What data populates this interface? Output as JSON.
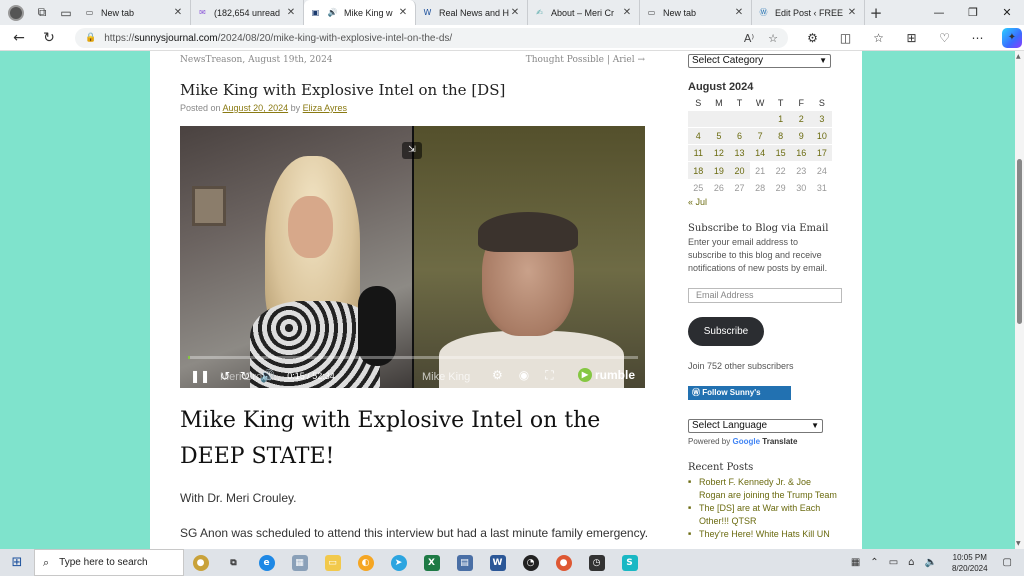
{
  "browser": {
    "tabs": [
      {
        "title": "New tab",
        "icon": "page-icon",
        "active": false
      },
      {
        "title": "(182,654 unread",
        "icon": "mail-icon",
        "active": false
      },
      {
        "title": "Mike King w",
        "icon": "site-icon",
        "active": true
      },
      {
        "title": "Real News and H",
        "icon": "w-icon",
        "active": false
      },
      {
        "title": "About – Meri Cr",
        "icon": "sign-icon",
        "active": false
      },
      {
        "title": "New tab",
        "icon": "page-icon",
        "active": false
      },
      {
        "title": "Edit Post ‹ FREE",
        "icon": "wordpress-icon",
        "active": false
      }
    ],
    "url_prefix": "https://",
    "url_domain": "sunnysjournal.com",
    "url_path": "/2024/08/20/mike-king-with-explosive-intel-on-the-ds/"
  },
  "post_nav": {
    "prev": "NewsTreason, August 19th, 2024",
    "next": "Thought Possible | Ariel →"
  },
  "post": {
    "title": "Mike King with Explosive Intel on the [DS]",
    "posted_on": "Posted on",
    "date": "August 20, 2024",
    "by": "by",
    "author": "Eliza Ayres",
    "big_title": "Mike King with Explosive Intel on the DEEP STATE!",
    "para1": "With Dr. Meri Crouley.",
    "para2": "SG Anon was scheduled to attend this interview but had a last minute family emergency."
  },
  "video": {
    "left_name": "Meri Croul...",
    "right_name": "Mike King",
    "time": "0:15 / 52:34",
    "progress": 0.005,
    "brand": "rumble"
  },
  "sidebar": {
    "category_select": "Select Category",
    "calendar": {
      "title": "August 2024",
      "weekdays": [
        "S",
        "M",
        "T",
        "W",
        "T",
        "F",
        "S"
      ],
      "prev_link": "« Jul",
      "weeks": [
        [
          "",
          "",
          "",
          "",
          "1",
          "2",
          "3"
        ],
        [
          "4",
          "5",
          "6",
          "7",
          "8",
          "9",
          "10"
        ],
        [
          "11",
          "12",
          "13",
          "14",
          "15",
          "16",
          "17"
        ],
        [
          "18",
          "19",
          "20",
          "21",
          "22",
          "23",
          "24"
        ],
        [
          "25",
          "26",
          "27",
          "28",
          "29",
          "30",
          "31"
        ]
      ],
      "post_days": [
        "1",
        "2",
        "3",
        "4",
        "5",
        "6",
        "7",
        "8",
        "9",
        "10",
        "11",
        "12",
        "13",
        "14",
        "15",
        "16",
        "17",
        "18",
        "19",
        "20"
      ]
    },
    "subscribe_title": "Subscribe to Blog via Email",
    "subscribe_text": "Enter your email address to subscribe to this blog and receive notifications of new posts by email.",
    "email_placeholder": "Email Address",
    "subscribe_button": "Subscribe",
    "subscribers": "Join 752 other subscribers",
    "follow_button": "Follow Sunny's Journal",
    "language_select": "Select Language",
    "powered_by": "Powered by",
    "google": "Google",
    "translate": "Translate",
    "recent_title": "Recent Posts",
    "recent_posts": [
      "Robert F. Kennedy Jr. & Joe Rogan are joining the Trump Team",
      "The [DS] are at War with Each Other!!! QTSR",
      "They're Here! White Hats Kill UN"
    ]
  },
  "taskbar": {
    "search_placeholder": "Type here to search",
    "time": "10:05 PM",
    "date": "8/20/2024"
  },
  "colors": {
    "page_background": "#7fe3cc",
    "link": "#8a7a12",
    "rumble_green": "#85c742"
  }
}
